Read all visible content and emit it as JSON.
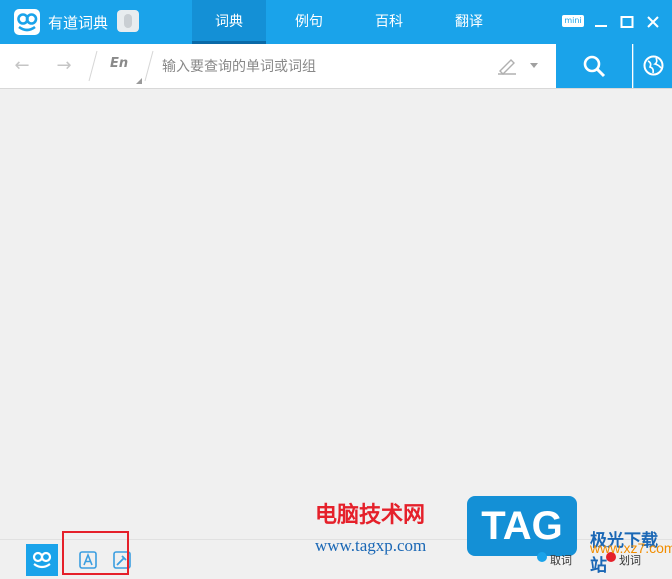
{
  "app": {
    "title": "有道词典"
  },
  "nav": {
    "tabs": [
      "词典",
      "例句",
      "百科",
      "翻译"
    ],
    "active_index": 0
  },
  "window": {
    "mini_label": "mini"
  },
  "search": {
    "language": "En",
    "placeholder": "输入要查询的单词或词组"
  },
  "colors": {
    "brand": "#1aa3ea",
    "brand_dark": "#1490d6",
    "highlight_box": "#e5202a"
  },
  "bottom": {
    "buttons": [
      "dict-mode-icon",
      "translate-card-icon",
      "screen-word-icon"
    ]
  },
  "watermark": {
    "site_name": "电脑技术网",
    "site_url": "www.tagxp.com",
    "tag_logo": "TAG",
    "right_label": "极光下载站",
    "right_url": "www.xz7.com",
    "option1": "取词",
    "option2": "划词"
  }
}
